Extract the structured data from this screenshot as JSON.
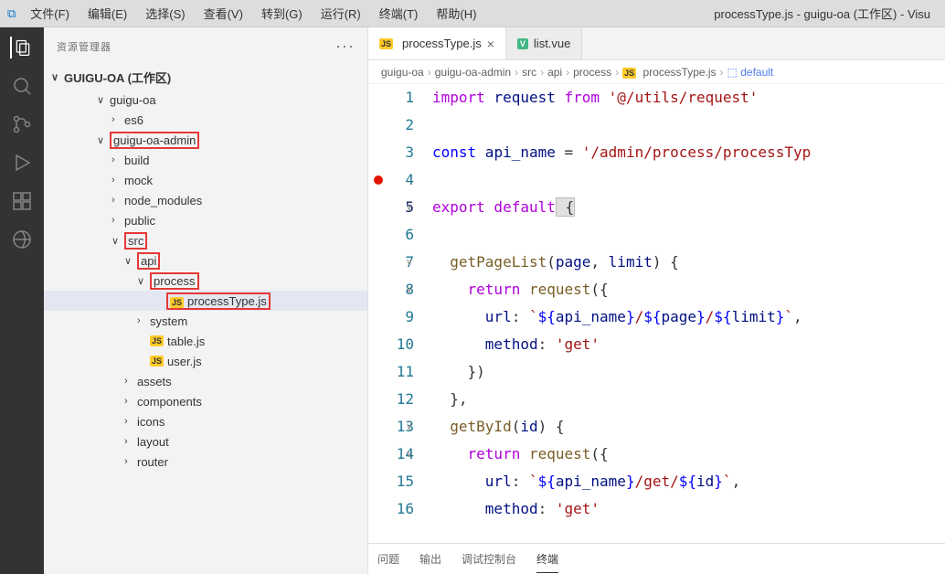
{
  "menubar": {
    "items": [
      "文件(F)",
      "编辑(E)",
      "选择(S)",
      "查看(V)",
      "转到(G)",
      "运行(R)",
      "终端(T)",
      "帮助(H)"
    ],
    "title": "processType.js - guigu-oa (工作区) - Visu"
  },
  "sidebar": {
    "title": "资源管理器",
    "workspace": "GUIGU-OA (工作区)",
    "tree": [
      {
        "label": "guigu-oa",
        "indent": 18,
        "chev": "∨"
      },
      {
        "label": "es6",
        "indent": 34,
        "chev": "›"
      },
      {
        "label": "guigu-oa-admin",
        "indent": 18,
        "chev": "∨",
        "red": true
      },
      {
        "label": "build",
        "indent": 34,
        "chev": "›"
      },
      {
        "label": "mock",
        "indent": 34,
        "chev": "›"
      },
      {
        "label": "node_modules",
        "indent": 34,
        "chev": "›"
      },
      {
        "label": "public",
        "indent": 34,
        "chev": "›"
      },
      {
        "label": "src",
        "indent": 34,
        "chev": "∨",
        "red": true
      },
      {
        "label": "api",
        "indent": 48,
        "chev": "∨",
        "red": true
      },
      {
        "label": "process",
        "indent": 62,
        "chev": "∨",
        "red": true
      },
      {
        "label": "processType.js",
        "indent": 80,
        "js": true,
        "red": true,
        "selected": true
      },
      {
        "label": "system",
        "indent": 62,
        "chev": "›"
      },
      {
        "label": "table.js",
        "indent": 62,
        "js": true
      },
      {
        "label": "user.js",
        "indent": 62,
        "js": true
      },
      {
        "label": "assets",
        "indent": 48,
        "chev": "›"
      },
      {
        "label": "components",
        "indent": 48,
        "chev": "›"
      },
      {
        "label": "icons",
        "indent": 48,
        "chev": "›"
      },
      {
        "label": "layout",
        "indent": 48,
        "chev": "›"
      },
      {
        "label": "router",
        "indent": 48,
        "chev": "›"
      }
    ]
  },
  "tabs": [
    {
      "label": "processType.js",
      "type": "js",
      "active": true,
      "close": true
    },
    {
      "label": "list.vue",
      "type": "vue",
      "active": false
    }
  ],
  "breadcrumb": [
    "guigu-oa",
    "guigu-oa-admin",
    "src",
    "api",
    "process",
    "processType.js",
    "default"
  ],
  "code": {
    "lines": [
      {
        "n": 1,
        "tokens": [
          [
            "kw",
            "import"
          ],
          [
            "",
            ""
          ],
          [
            "var",
            " request "
          ],
          [
            "kw",
            "from"
          ],
          [
            "str",
            " '@/utils/request'"
          ]
        ]
      },
      {
        "n": 2,
        "tokens": []
      },
      {
        "n": 3,
        "tokens": [
          [
            "kw2",
            "const"
          ],
          [
            "var",
            " api_name "
          ],
          [
            "",
            "="
          ],
          [
            "str",
            " '/admin/process/processTyp"
          ]
        ]
      },
      {
        "n": 4,
        "tokens": [],
        "bp": true
      },
      {
        "n": 5,
        "fold": "∨",
        "current": true,
        "tokens": [
          [
            "kw",
            "export"
          ],
          [
            "kw",
            " default"
          ],
          [
            "",
            ""
          ],
          [
            "brace-hl",
            " {"
          ]
        ]
      },
      {
        "n": 6,
        "tokens": []
      },
      {
        "n": 7,
        "fold": "∨",
        "tokens": [
          [
            "",
            "  "
          ],
          [
            "fn",
            "getPageList"
          ],
          [
            "",
            "("
          ],
          [
            "var",
            "page"
          ],
          [
            "",
            ", "
          ],
          [
            "var",
            "limit"
          ],
          [
            "",
            ") {"
          ]
        ]
      },
      {
        "n": 8,
        "fold": "∨",
        "tokens": [
          [
            "",
            "    "
          ],
          [
            "kw",
            "return"
          ],
          [
            "",
            ""
          ],
          [
            "fn",
            " request"
          ],
          [
            "",
            "({"
          ]
        ]
      },
      {
        "n": 9,
        "tokens": [
          [
            "",
            "      "
          ],
          [
            "var",
            "url"
          ],
          [
            "",
            ":"
          ],
          [
            "tmpl",
            " `"
          ],
          [
            "tmplexp",
            "${"
          ],
          [
            "var",
            "api_name"
          ],
          [
            "tmplexp",
            "}"
          ],
          [
            "tmpl",
            "/"
          ],
          [
            "tmplexp",
            "${"
          ],
          [
            "var",
            "page"
          ],
          [
            "tmplexp",
            "}"
          ],
          [
            "tmpl",
            "/"
          ],
          [
            "tmplexp",
            "${"
          ],
          [
            "var",
            "limit"
          ],
          [
            "tmplexp",
            "}"
          ],
          [
            "tmpl",
            "`"
          ],
          [
            "",
            ","
          ]
        ]
      },
      {
        "n": 10,
        "tokens": [
          [
            "",
            "      "
          ],
          [
            "var",
            "method"
          ],
          [
            "",
            ":"
          ],
          [
            "str",
            " 'get'"
          ]
        ]
      },
      {
        "n": 11,
        "tokens": [
          [
            "",
            "    })"
          ]
        ]
      },
      {
        "n": 12,
        "tokens": [
          [
            "",
            "  },"
          ]
        ]
      },
      {
        "n": 13,
        "fold": "∨",
        "tokens": [
          [
            "",
            "  "
          ],
          [
            "fn",
            "getById"
          ],
          [
            "",
            "("
          ],
          [
            "var",
            "id"
          ],
          [
            "",
            ") {"
          ]
        ]
      },
      {
        "n": 14,
        "fold": "∨",
        "tokens": [
          [
            "",
            "    "
          ],
          [
            "kw",
            "return"
          ],
          [
            "",
            ""
          ],
          [
            "fn",
            " request"
          ],
          [
            "",
            "({"
          ]
        ]
      },
      {
        "n": 15,
        "tokens": [
          [
            "",
            "      "
          ],
          [
            "var",
            "url"
          ],
          [
            "",
            ":"
          ],
          [
            "tmpl",
            " `"
          ],
          [
            "tmplexp",
            "${"
          ],
          [
            "var",
            "api_name"
          ],
          [
            "tmplexp",
            "}"
          ],
          [
            "tmpl",
            "/get/"
          ],
          [
            "tmplexp",
            "${"
          ],
          [
            "var",
            "id"
          ],
          [
            "tmplexp",
            "}"
          ],
          [
            "tmpl",
            "`"
          ],
          [
            "",
            ","
          ]
        ]
      },
      {
        "n": 16,
        "tokens": [
          [
            "",
            "      "
          ],
          [
            "var",
            "method"
          ],
          [
            "",
            ":"
          ],
          [
            "str",
            " 'get'"
          ]
        ]
      }
    ]
  },
  "panel": {
    "tabs": [
      "问题",
      "输出",
      "调试控制台",
      "终端"
    ],
    "active": 3
  }
}
